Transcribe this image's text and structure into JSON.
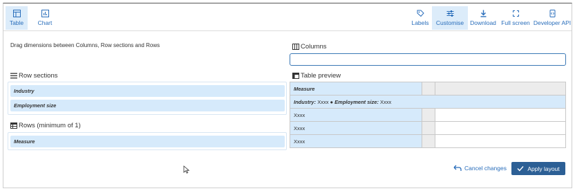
{
  "toolbar": {
    "left": [
      {
        "label": "Table",
        "icon": "table-icon",
        "active": true
      },
      {
        "label": "Chart",
        "icon": "chart-icon"
      }
    ],
    "right": [
      {
        "label": "Labels",
        "icon": "tag-icon"
      },
      {
        "label": "Customise",
        "icon": "sliders-icon",
        "active": true
      },
      {
        "label": "Download",
        "icon": "download-icon"
      },
      {
        "label": "Full screen",
        "icon": "fullscreen-icon"
      },
      {
        "label": "Developer API",
        "icon": "api-icon"
      }
    ]
  },
  "instructions": "Drag dimensions between Columns, Row sections and Rows",
  "row_sections": {
    "title": "Row sections",
    "items": [
      "Industry",
      "Employment size"
    ]
  },
  "rows": {
    "title": "Rows (minimum of 1)",
    "items": [
      "Measure"
    ]
  },
  "columns": {
    "title": "Columns",
    "value": ""
  },
  "preview": {
    "title": "Table preview",
    "header": "Measure",
    "section_label_1": "Industry:",
    "section_value_1": "Xxxx",
    "section_label_2": "Employment size:",
    "section_value_2": "Xxxx",
    "rows": [
      "Xxxx",
      "Xxxx",
      "Xxxx"
    ]
  },
  "actions": {
    "cancel": "Cancel changes",
    "apply": "Apply layout"
  },
  "colors": {
    "accent": "#2a6ebb",
    "chip_bg": "#d6eafb",
    "apply_bg": "#2c5f95"
  }
}
